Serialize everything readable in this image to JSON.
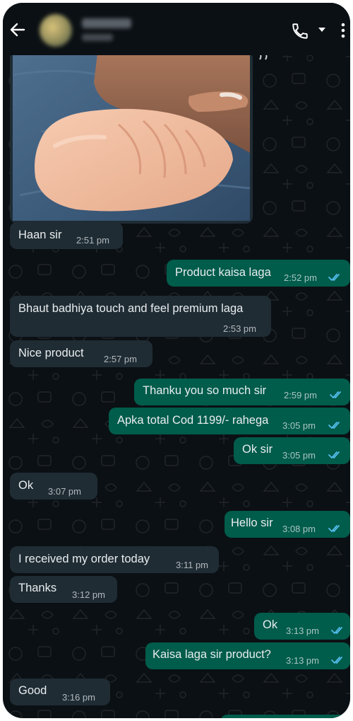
{
  "header": {
    "back_icon": "arrow-left-icon",
    "call_icon": "phone-icon",
    "dropdown_icon": "triangle-down-icon",
    "menu_icon": "vertical-dots-icon"
  },
  "colors": {
    "background": "#0b1014",
    "incoming_bubble": "#1f2c34",
    "outgoing_bubble": "#005c4b",
    "read_ticks": "#53bdeb"
  },
  "messages": [
    {
      "direction": "in",
      "text": "Haan sir",
      "time": "2:51 pm"
    },
    {
      "direction": "out",
      "text": "Product kaisa laga",
      "time": "2:52 pm"
    },
    {
      "direction": "in",
      "text": "Bhaut badhiya touch and feel premium laga",
      "time": "2:53 pm"
    },
    {
      "direction": "in",
      "text": "Nice product",
      "time": "2:57 pm"
    },
    {
      "direction": "out",
      "text": "Thanku you so much sir",
      "time": "2:59 pm"
    },
    {
      "direction": "out",
      "text": "Apka total Cod 1199/- rahega",
      "time": "3:05 pm"
    },
    {
      "direction": "out",
      "text": "Ok sir",
      "time": "3:05 pm"
    },
    {
      "direction": "in",
      "text": "Ok",
      "time": "3:07 pm"
    },
    {
      "direction": "out",
      "text": "Hello sir",
      "time": "3:08 pm"
    },
    {
      "direction": "in",
      "text": "I received my order today",
      "time": "3:11 pm"
    },
    {
      "direction": "in",
      "text": "Thanks",
      "time": "3:12 pm"
    },
    {
      "direction": "out",
      "text": "Ok",
      "time": "3:13 pm"
    },
    {
      "direction": "out",
      "text": "Kaisa laga sir product?",
      "time": "3:13 pm"
    },
    {
      "direction": "in",
      "text": "Good",
      "time": "3:16 pm"
    }
  ]
}
